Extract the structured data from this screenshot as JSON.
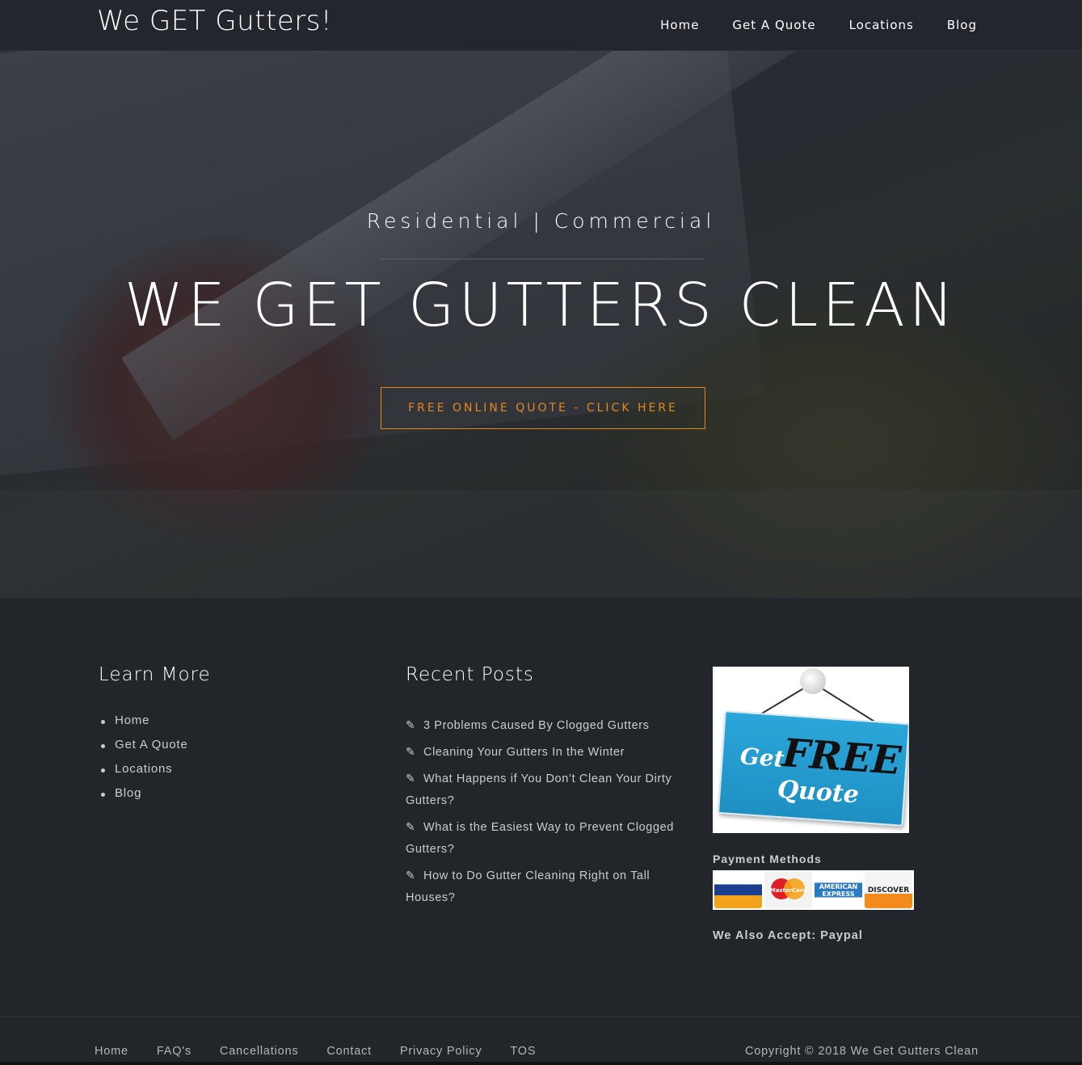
{
  "header": {
    "logo": "We GET Gutters!",
    "nav": [
      "Home",
      "Get A Quote",
      "Locations",
      "Blog"
    ]
  },
  "hero": {
    "subtitle": "Residential | Commercial",
    "title": "WE GET GUTTERS CLEAN",
    "cta": "FREE ONLINE QUOTE - CLICK HERE"
  },
  "learn_more": {
    "title": "Learn More",
    "items": [
      "Home",
      "Get A Quote",
      "Locations",
      "Blog"
    ]
  },
  "recent_posts": {
    "title": "Recent Posts",
    "items": [
      "3 Problems Caused By Clogged Gutters",
      "Cleaning Your Gutters In the Winter",
      "What Happens if You Don’t Clean Your Dirty Gutters?",
      "What is the Easiest Way to Prevent Clogged Gutters?",
      "How to Do Gutter Cleaning Right on Tall Houses?"
    ]
  },
  "sidebar": {
    "quote_image": {
      "get": "Get",
      "free": "FREE",
      "quote": "Quote"
    },
    "payment_label": "Payment Methods",
    "cards": {
      "visa": "VISA",
      "mastercard": "MasterCard",
      "amex": "AMERICAN EXPRESS",
      "discover": "DISCOVER"
    },
    "also_accept": "We Also Accept: Paypal"
  },
  "footer": {
    "links": [
      "Home",
      "FAQ's",
      "Cancellations",
      "Contact",
      "Privacy Policy",
      "TOS"
    ],
    "copyright": "Copyright © 2018 We Get Gutters Clean"
  },
  "colors": {
    "accent": "#e8871e",
    "background": "#22262b",
    "text": "#c9ccd0"
  },
  "icons": {
    "post_bullet": "pencil-icon"
  }
}
